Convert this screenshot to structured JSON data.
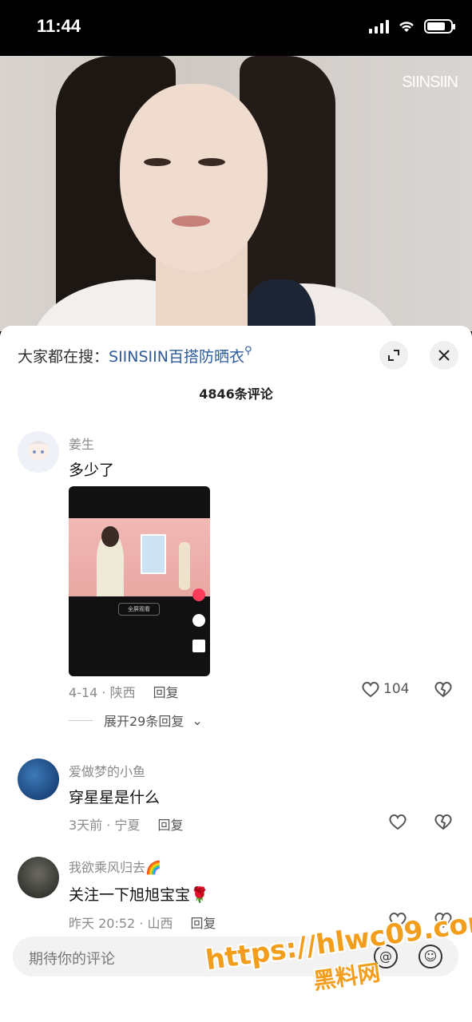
{
  "status_bar": {
    "time": "11:44",
    "battery_level": 0.8
  },
  "video": {
    "brand": "SIINSIIN"
  },
  "header": {
    "search_prefix": "大家都在搜：",
    "search_term": "SIINSIIN百搭防晒衣",
    "comment_count": "4846条评论",
    "expand_icon": "expand-icon",
    "close_icon": "close-icon"
  },
  "comments": [
    {
      "name": "姜生",
      "text": "多少了",
      "meta": "4-14 · 陕西",
      "reply": "回复",
      "likes": "104",
      "has_image": true,
      "image_chip": "全屏观看"
    },
    {
      "name": "爱做梦的小鱼",
      "text": "穿星星是什么",
      "meta": "3天前 · 宁夏",
      "reply": "回复",
      "likes": ""
    },
    {
      "name": "我欲乘风归去🌈",
      "text": "关注一下旭旭宝宝🌹",
      "meta": "昨天 20:52 · 山西",
      "reply": "回复",
      "likes": ""
    }
  ],
  "expand_replies": "展开29条回复",
  "input": {
    "placeholder": "期待你的评论"
  },
  "watermark": {
    "line1": "https://hlwc09.com",
    "line2": "黑料网"
  },
  "colors": {
    "search_term": "#2d5b9c",
    "watermark": "#f39d1d"
  }
}
